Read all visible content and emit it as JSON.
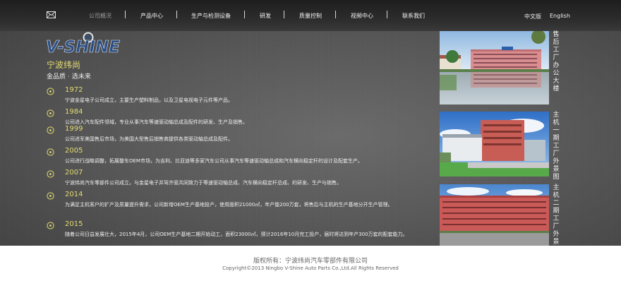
{
  "nav": {
    "items": [
      "公司概况",
      "产品中心",
      "生产与检测设备",
      "研发",
      "质量控制",
      "视频中心",
      "联系我们"
    ],
    "lang_cn": "中文版",
    "lang_en": "English"
  },
  "brand": {
    "logo_text": "V-SHINE",
    "company_name": "宁波纬尚",
    "slogan_a": "金品质",
    "slogan_sep": "·",
    "slogan_b": "选未来",
    "accent_color": "#e3dc72"
  },
  "timeline": [
    {
      "year": "1972",
      "text": "宁波金星电子公司成立，主要生产塑料制品，以及卫星电视电子元件等产品。"
    },
    {
      "year": "1984",
      "text": "公司进入汽车配件领域，专业从事汽车等速驱动轴总成及配件的研发、生产及销售。"
    },
    {
      "year": "1999",
      "text": "公司进军美国售后市场，为美国大型售后销售商提供各类驱动轴总成及配件。"
    },
    {
      "year": "2005",
      "text": "公司进行战略调整，拓展整车OEM市场，为吉利、比亚迪等多家汽车公司从事汽车等速驱动轴总成和汽车横向稳定杆的设计及配套生产。"
    },
    {
      "year": "2007",
      "text": "宁波纬尚汽车零部件公司成立。与金星电子并驾齐驱共同致力于等速驱动轴总成、汽车横向稳定杆总成、的研发、生产与销售。"
    },
    {
      "year": "2014",
      "text": "为满足主机客户的扩产及质量提升需求，公司新增OEM生产基地投产，使用面积21000㎡，年产能200万套，将售后与主机的生产基地分开生产管理。"
    },
    {
      "year": "2015",
      "text": "随着公司日益发展壮大，2015年4月，公司OEM生产基地二期开始动工，面积23000㎡，预计2016年10月完工投产，届时将达到年产300万套的配套能力。"
    }
  ],
  "photos": [
    {
      "caption": "售后工厂办公大楼"
    },
    {
      "caption": "主机一期工厂外景图"
    },
    {
      "caption": "主机二期工厂外景图"
    }
  ],
  "footer": {
    "line1": "版权所有：宁波纬尚汽车零部件有限公司",
    "line2": "Copyright©2013 Ningbo V-Shine Auto Parts Co.,Ltd.All Rights Reserved"
  }
}
